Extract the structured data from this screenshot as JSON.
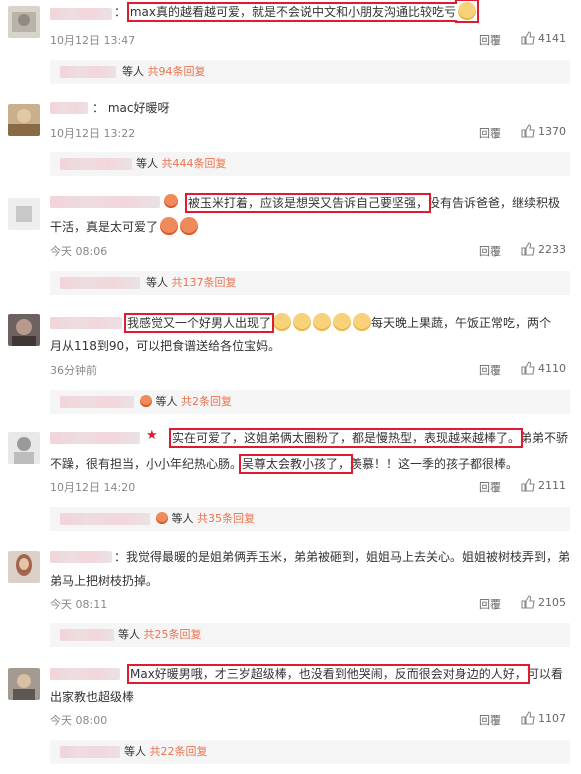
{
  "reply_label": "回覆",
  "comments": [
    {
      "name_prefix": "：",
      "text": "max真的越看越可爱，就是不会说中文和小朋友沟通比较吃亏",
      "time": "10月12日 13:47",
      "likes": "4141",
      "summary": {
        "label": "等人",
        "count": "共94条回复"
      }
    },
    {
      "name_prefix": "：",
      "text": "mac好暖呀",
      "time": "10月12日 13:22",
      "likes": "1370",
      "summary": {
        "label": "等人",
        "count": "共444条回复"
      }
    },
    {
      "text_hl": "被玉米打着，应该是想哭又告诉自己要坚强，",
      "text_rest": "没有告诉爸爸，继续积极",
      "line2": "干活，真是太可爱了",
      "time": "今天 08:06",
      "likes": "2233",
      "summary": {
        "label": "等人",
        "count": "共137条回复"
      }
    },
    {
      "text_hl": "我感觉又一个好男人出现了",
      "text_rest": "每天晚上果蔬，午饭正常吃，两个",
      "line2": "月从118到90，可以把食谱送给各位宝妈。",
      "time": "36分钟前",
      "likes": "4110",
      "summary": {
        "label": "等人",
        "count": "共2条回复"
      }
    },
    {
      "text_hl": "实在可爱了，这姐弟俩太圈粉了，都是慢热型，表现越来越棒了。",
      "text_rest": "弟弟不骄",
      "line2a": "不躁，很有担当，小小年纪热心肠。",
      "line2_hl": "吴尊太会教小孩了，",
      "line2b": "羡慕！！这一季的孩子都很棒。",
      "time": "10月12日 14:20",
      "likes": "2111",
      "summary": {
        "label": "等人",
        "count": "共35条回复"
      }
    },
    {
      "name_prefix": "：",
      "text": "我觉得最暖的是姐弟俩弄玉米，弟弟被砸到，姐姐马上去关心。姐姐被树枝弄到，弟",
      "line2": "弟马上把树枝扔掉。",
      "time": "今天 08:11",
      "likes": "2105",
      "summary": {
        "label": "等人",
        "count": "共25条回复"
      }
    },
    {
      "text_hl": "Max好暖男哦，才三岁超级棒，也没看到他哭闹，反而很会对身边的人好，",
      "text_rest": "可以看",
      "line2": "出家教也超级棒",
      "time": "今天 08:00",
      "likes": "1107",
      "summary": {
        "label": "等人",
        "count": "共22条回复"
      }
    }
  ]
}
